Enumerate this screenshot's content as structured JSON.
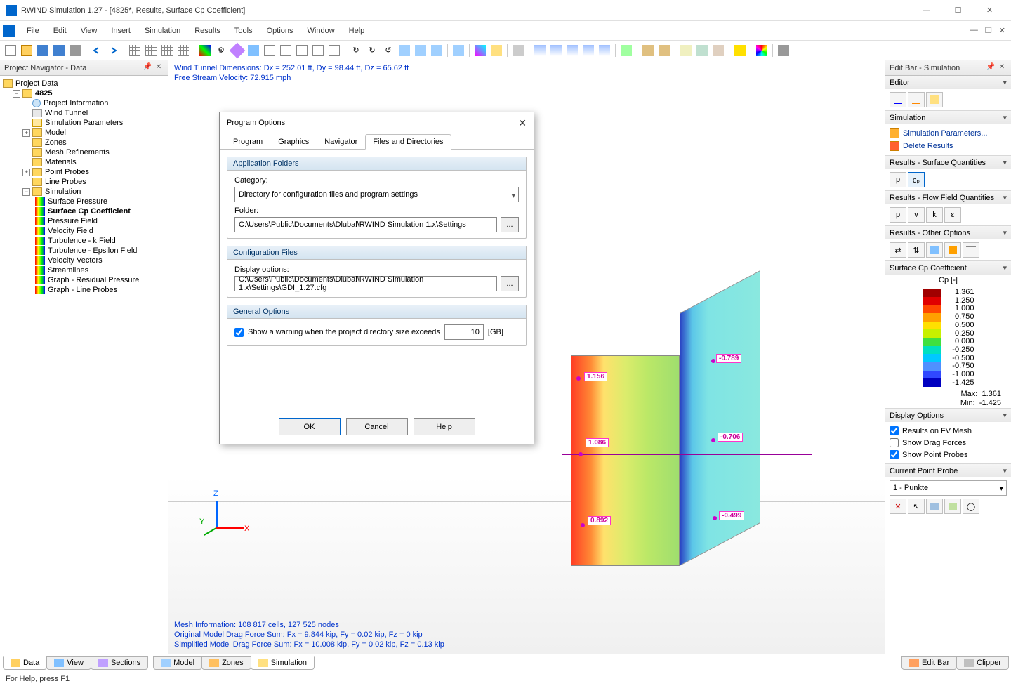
{
  "titlebar": {
    "text": "RWIND Simulation 1.27 - [4825*, Results, Surface Cp Coefficient]"
  },
  "menu": {
    "items": [
      "File",
      "Edit",
      "View",
      "Insert",
      "Simulation",
      "Results",
      "Tools",
      "Options",
      "Window",
      "Help"
    ]
  },
  "nav": {
    "title": "Project Navigator - Data",
    "root": "Project Data",
    "project": "4825",
    "items": [
      "Project Information",
      "Wind Tunnel",
      "Simulation Parameters",
      "Model",
      "Zones",
      "Mesh Refinements",
      "Materials",
      "Point Probes",
      "Line Probes",
      "Simulation"
    ],
    "sim_children": [
      "Surface Pressure",
      "Surface Cp Coefficient",
      "Pressure Field",
      "Velocity Field",
      "Turbulence - k Field",
      "Turbulence - Epsilon Field",
      "Velocity Vectors",
      "Streamlines",
      "Graph - Residual Pressure",
      "Graph - Line Probes"
    ]
  },
  "viewport": {
    "top1": "Wind Tunnel Dimensions: Dx = 252.01 ft, Dy = 98.44 ft, Dz = 65.62 ft",
    "top2": "Free Stream Velocity: 72.915 mph",
    "bot1": "Mesh Information: 108 817 cells, 127 525 nodes",
    "bot2": "Original Model Drag Force Sum: Fx = 9.844 kip, Fy = 0.02 kip, Fz = 0 kip",
    "bot3": "Simplified Model Drag Force Sum: Fx = 10.008 kip, Fy = 0.02 kip, Fz = 0.13 kip",
    "axes": {
      "z": "Z",
      "x": "X",
      "y": "Y"
    },
    "probes": [
      "1.156",
      "1.086",
      "0.892",
      "-0.789",
      "-0.706",
      "-0.499"
    ]
  },
  "editbar": {
    "title": "Edit Bar - Simulation",
    "sections": {
      "editor": "Editor",
      "simulation": "Simulation",
      "sim_links": [
        "Simulation Parameters...",
        "Delete Results"
      ],
      "res_surf": "Results - Surface Quantities",
      "res_flow": "Results - Flow Field Quantities",
      "res_other": "Results - Other Options",
      "surfcp": "Surface Cp Coefficient",
      "display": "Display Options",
      "pointprobe": "Current Point Probe"
    },
    "flow_btns": [
      "p",
      "v",
      "k",
      "ε"
    ],
    "surf_btns": [
      "p",
      "cₚ"
    ],
    "legend": {
      "title": "Cp [-]",
      "values": [
        "1.361",
        "1.250",
        "1.000",
        "0.750",
        "0.500",
        "0.250",
        "0.000",
        "-0.250",
        "-0.500",
        "-0.750",
        "-1.000",
        "-1.425"
      ],
      "colors": [
        "#a00000",
        "#e00000",
        "#ff4800",
        "#ffa000",
        "#ffe000",
        "#c8f000",
        "#40e040",
        "#00e0c0",
        "#00c8ff",
        "#5090ff",
        "#3048ff",
        "#0000c0"
      ],
      "max_lbl": "Max:",
      "max": "1.361",
      "min_lbl": "Min:",
      "min": "-1.425"
    },
    "display_opts": [
      {
        "label": "Results on FV Mesh",
        "checked": true
      },
      {
        "label": "Show Drag Forces",
        "checked": false
      },
      {
        "label": "Show Point Probes",
        "checked": true
      }
    ],
    "probe_select": "1 - Punkte"
  },
  "dialog": {
    "title": "Program Options",
    "tabs": [
      "Program",
      "Graphics",
      "Navigator",
      "Files and Directories"
    ],
    "active_tab": "Files and Directories",
    "group1": {
      "title": "Application Folders",
      "cat_label": "Category:",
      "cat_value": "Directory for configuration files and program settings",
      "folder_label": "Folder:",
      "folder_value": "C:\\Users\\Public\\Documents\\Dlubal\\RWIND Simulation 1.x\\Settings"
    },
    "group2": {
      "title": "Configuration Files",
      "disp_label": "Display options:",
      "disp_value": "C:\\Users\\Public\\Documents\\Dlubal\\RWIND Simulation 1.x\\Settings\\GDI_1.27.cfg"
    },
    "group3": {
      "title": "General Options",
      "warn_label": "Show a warning when the project directory size exceeds",
      "warn_value": "10",
      "warn_unit": "[GB]"
    },
    "btns": {
      "ok": "OK",
      "cancel": "Cancel",
      "help": "Help"
    }
  },
  "bottom_tabs": {
    "left": [
      "Data",
      "View",
      "Sections"
    ],
    "center": [
      "Model",
      "Zones",
      "Simulation"
    ],
    "right": [
      "Edit Bar",
      "Clipper"
    ]
  },
  "status": "For Help, press F1",
  "chart_data": {
    "type": "table",
    "title": "Surface Cp Coefficient color legend",
    "series": [
      {
        "name": "Cp [-]",
        "values": [
          1.361,
          1.25,
          1.0,
          0.75,
          0.5,
          0.25,
          0.0,
          -0.25,
          -0.5,
          -0.75,
          -1.0,
          -1.425
        ]
      }
    ],
    "max": 1.361,
    "min": -1.425,
    "point_probes": [
      1.156,
      1.086,
      0.892,
      -0.789,
      -0.706,
      -0.499
    ]
  }
}
